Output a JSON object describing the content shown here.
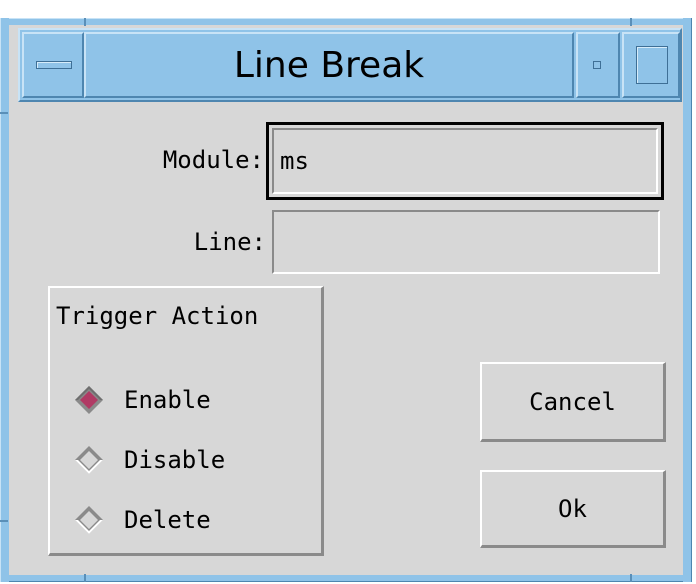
{
  "window": {
    "title": "Line Break"
  },
  "form": {
    "module_label": "Module:",
    "module_value": "ms",
    "line_label": "Line:",
    "line_value": ""
  },
  "trigger_action": {
    "title": "Trigger Action",
    "options": [
      {
        "label": "Enable",
        "selected": true
      },
      {
        "label": "Disable",
        "selected": false
      },
      {
        "label": "Delete",
        "selected": false
      }
    ]
  },
  "buttons": {
    "cancel_label": "Cancel",
    "ok_label": "Ok"
  },
  "colors": {
    "frame": "#8fc3e8",
    "background": "#d7d7d7",
    "radio_selected": "#b03a64"
  },
  "icons": [
    "window-menu-icon",
    "minimize-icon",
    "maximize-icon",
    "radio-diamond-icon"
  ]
}
